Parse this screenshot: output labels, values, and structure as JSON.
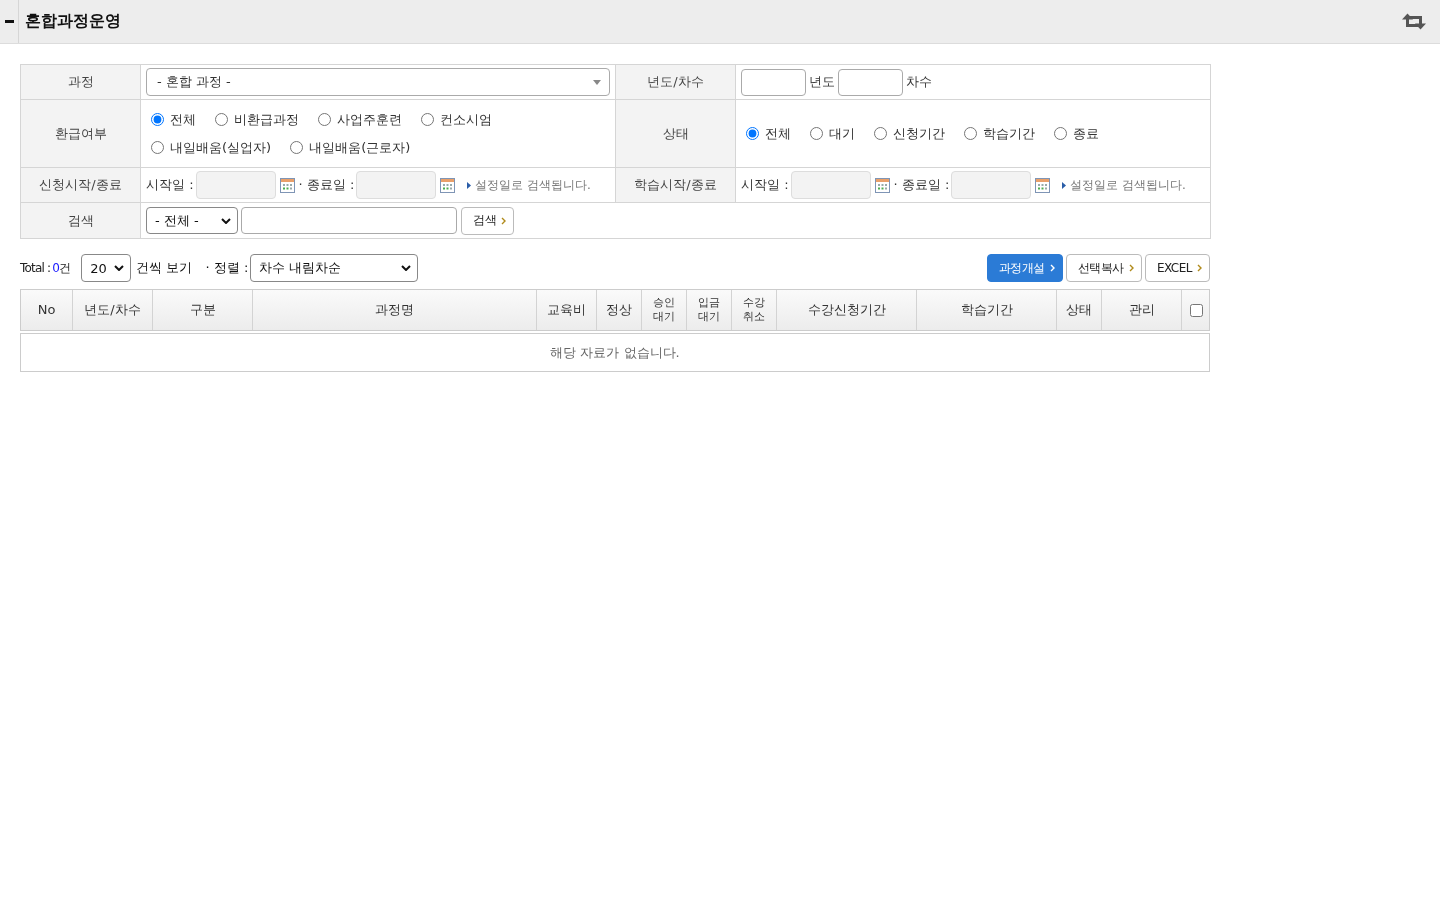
{
  "header": {
    "title": "혼합과정운영"
  },
  "search_form": {
    "course": {
      "label": "과정",
      "value": "- 혼합 과정 -"
    },
    "year_round": {
      "label": "년도/차수",
      "year_unit": "년도",
      "round_unit": "차수"
    },
    "refund": {
      "label": "환급여부",
      "option_lines": [
        [
          {
            "label": "전체",
            "selected": true
          },
          {
            "label": "비환급과정",
            "selected": false
          },
          {
            "label": "사업주훈련",
            "selected": false
          },
          {
            "label": "컨소시엄",
            "selected": false
          }
        ],
        [
          {
            "label": "내일배움(실업자)",
            "selected": false
          },
          {
            "label": "내일배움(근로자)",
            "selected": false
          }
        ]
      ]
    },
    "status": {
      "label": "상태",
      "options": [
        {
          "label": "전체",
          "selected": true
        },
        {
          "label": "대기",
          "selected": false
        },
        {
          "label": "신청기간",
          "selected": false
        },
        {
          "label": "학습기간",
          "selected": false
        },
        {
          "label": "종료",
          "selected": false
        }
      ]
    },
    "periods": [
      {
        "label": "신청시작/종료",
        "start_label": "시작일 :",
        "end_label": "· 종료일 :",
        "note": "설정일로 검색됩니다."
      },
      {
        "label": "학습시작/종료",
        "start_label": "시작일 :",
        "end_label": "· 종료일 :",
        "note": "설정일로 검색됩니다."
      }
    ],
    "search": {
      "label": "검색",
      "scope": "- 전체 -",
      "button": "검색"
    }
  },
  "toolbar": {
    "total_label": "Total :",
    "total_count": "0",
    "total_unit": "건",
    "page_size": "20",
    "page_size_suffix": "건씩 보기",
    "sort_label": "· 정렬 :",
    "sort": "차수 내림차순",
    "buttons": [
      {
        "label": "과정개설",
        "kind": "primary"
      },
      {
        "label": "선택복사",
        "kind": "default"
      },
      {
        "label": "EXCEL",
        "kind": "default"
      }
    ]
  },
  "results": {
    "columns": [
      {
        "kind": "text",
        "label": "No"
      },
      {
        "kind": "text",
        "label": "년도/차수"
      },
      {
        "kind": "text",
        "label": "구분"
      },
      {
        "kind": "text",
        "label": "과정명"
      },
      {
        "kind": "text",
        "label": "교육비"
      },
      {
        "kind": "text",
        "label": "정상"
      },
      {
        "kind": "text",
        "label": "승인 대기"
      },
      {
        "kind": "text",
        "label": "입금 대기"
      },
      {
        "kind": "text",
        "label": "수강 취소"
      },
      {
        "kind": "text",
        "label": "수강신청기간"
      },
      {
        "kind": "text",
        "label": "학습기간"
      },
      {
        "kind": "text",
        "label": "상태"
      },
      {
        "kind": "text",
        "label": "관리"
      },
      {
        "kind": "checkbox",
        "checked": false
      }
    ],
    "empty_message": "해당 자료가 없습니다."
  }
}
